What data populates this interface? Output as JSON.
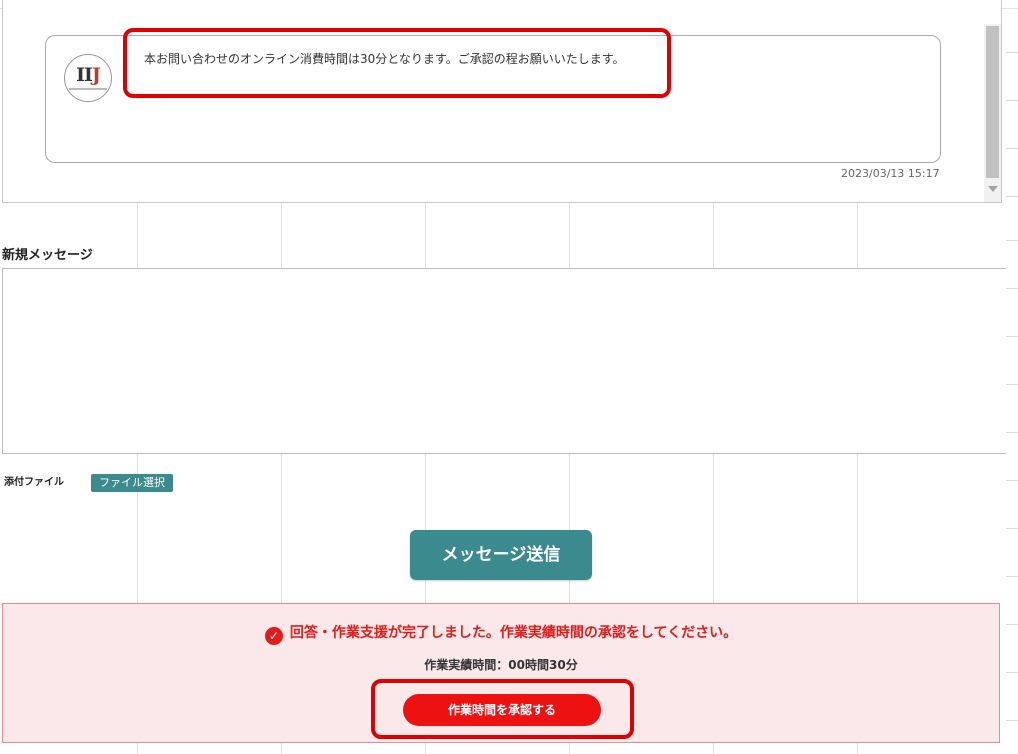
{
  "history": {
    "message": {
      "avatar_logo_main": "II",
      "avatar_logo_accent": "J",
      "text": "本お問い合わせのオンライン消費時間は30分となります。ご承認の程お願いいたします。",
      "timestamp": "2023/03/13 15:17"
    }
  },
  "compose": {
    "label": "新規メッセージ",
    "value": "",
    "attach_label": "添付ファイル",
    "file_button": "ファイル選択",
    "send_button": "メッセージ送信"
  },
  "notice": {
    "message": "回答・作業支援が完了しました。作業実績時間の承認をしてください。",
    "time_text": "作業実績時間：00時間30分",
    "approve_button": "作業時間を承認する"
  },
  "colors": {
    "accent_teal": "#3b8a8e",
    "alert_red": "#e21b1b",
    "highlight_red": "#e00000",
    "notice_bg": "#fbe9ea"
  }
}
